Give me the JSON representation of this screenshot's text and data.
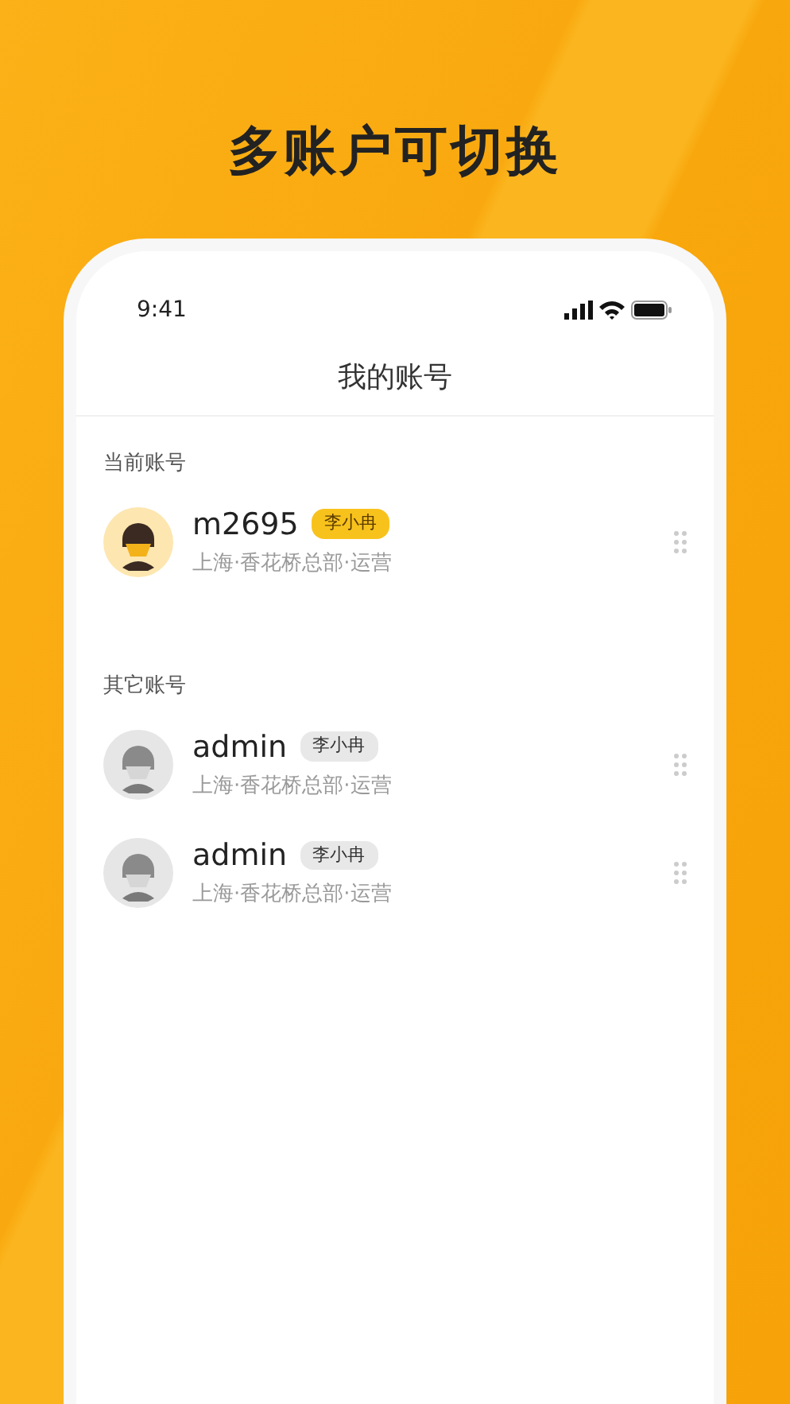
{
  "headline": "多账户可切换",
  "status_bar": {
    "time": "9:41"
  },
  "screen_title": "我的账号",
  "sections": [
    {
      "title": "当前账号",
      "accounts": [
        {
          "username": "m2695",
          "tag": "李小冉",
          "department": "上海·香花桥总部·运营",
          "active": true
        }
      ]
    },
    {
      "title": "其它账号",
      "accounts": [
        {
          "username": "admin",
          "tag": "李小冉",
          "department": "上海·香花桥总部·运营",
          "active": false
        },
        {
          "username": "admin",
          "tag": "李小冉",
          "department": "上海·香花桥总部·运营",
          "active": false
        }
      ]
    }
  ]
}
